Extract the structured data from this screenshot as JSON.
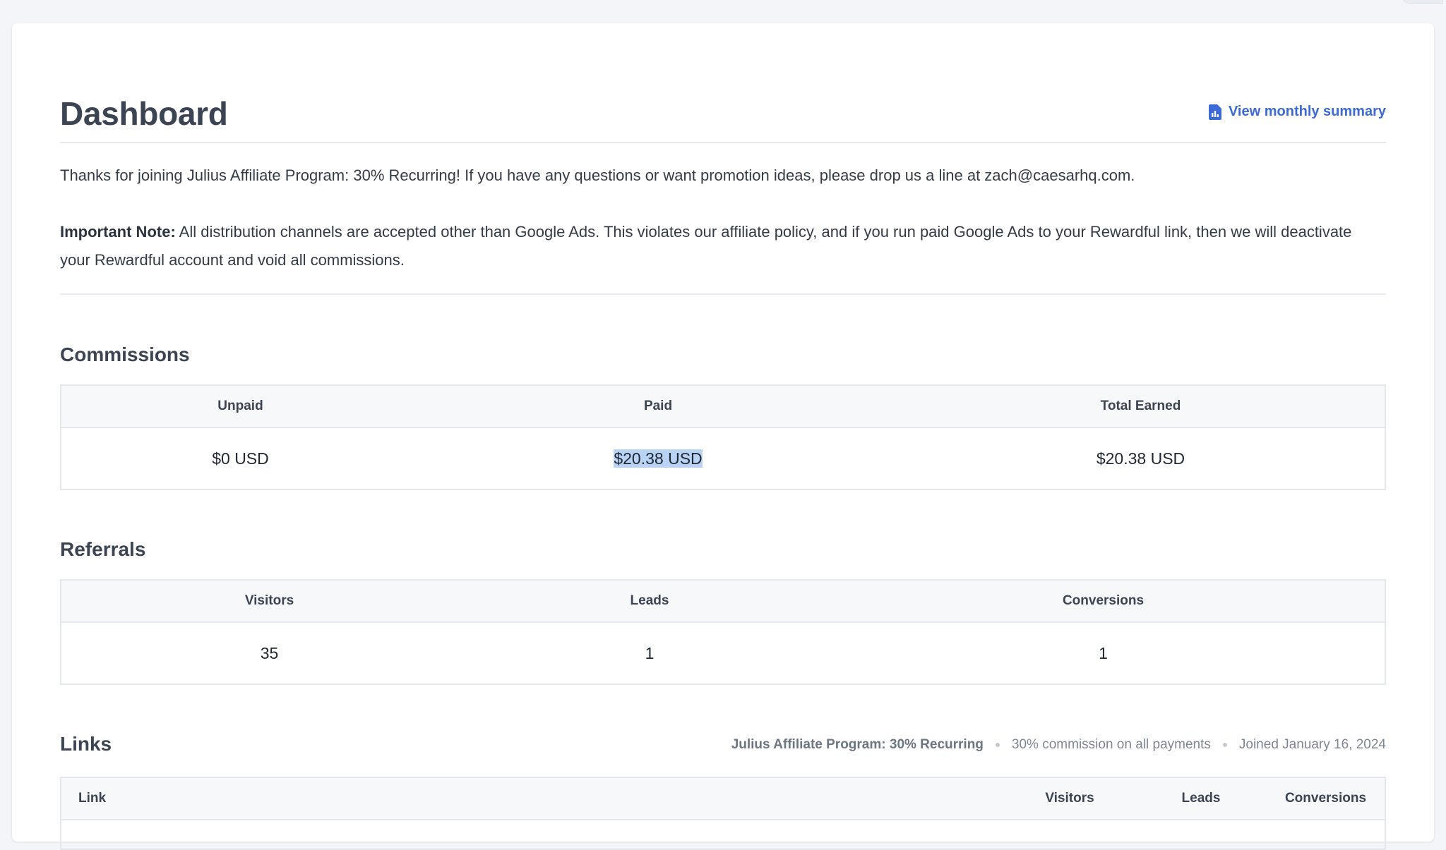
{
  "header": {
    "title": "Dashboard",
    "summary_link": "View monthly summary",
    "summary_icon": "report-icon"
  },
  "intro": {
    "welcome": "Thanks for joining Julius Affiliate Program: 30% Recurring! If you have any questions or want promotion ideas, please drop us a line at zach@caesarhq.com.",
    "note_label": "Important Note:",
    "note_text": " All distribution channels are accepted other than Google Ads. This violates our affiliate policy, and if you run paid Google Ads to your Rewardful link, then we will deactivate your Rewardful account and void all commissions."
  },
  "commissions": {
    "title": "Commissions",
    "columns": [
      "Unpaid",
      "Paid",
      "Total Earned"
    ],
    "values": [
      "$0 USD",
      "$20.38 USD",
      "$20.38 USD"
    ]
  },
  "referrals": {
    "title": "Referrals",
    "columns": [
      "Visitors",
      "Leads",
      "Conversions"
    ],
    "values": [
      "35",
      "1",
      "1"
    ]
  },
  "links": {
    "title": "Links",
    "program": "Julius Affiliate Program: 30% Recurring",
    "commission": "30% commission on all payments",
    "joined": "Joined January 16, 2024",
    "columns": [
      "Link",
      "Visitors",
      "Leads",
      "Conversions"
    ]
  },
  "colors": {
    "accent": "#3c6ad6",
    "selection": "#b9d3f5",
    "heading": "#3b4452"
  }
}
